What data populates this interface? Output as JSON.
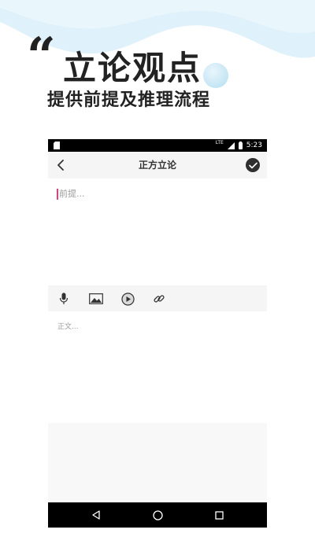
{
  "hero": {
    "quote_mark": "“",
    "title": "立论观点",
    "subtitle": "提供前提及推理流程"
  },
  "status_bar": {
    "network": "LTE",
    "time": "5:23"
  },
  "app_bar": {
    "title": "正方立论",
    "back_icon": "chevron-left-icon",
    "confirm_icon": "check-circle-icon"
  },
  "editor": {
    "premise_placeholder": "前提...",
    "body_placeholder": "正文..."
  },
  "toolbar": {
    "items": [
      {
        "icon": "microphone-icon"
      },
      {
        "icon": "image-icon"
      },
      {
        "icon": "play-circle-icon"
      },
      {
        "icon": "link-icon"
      }
    ]
  },
  "nav_bar": {
    "items": [
      {
        "icon": "back-triangle-icon"
      },
      {
        "icon": "home-circle-icon"
      },
      {
        "icon": "recents-square-icon"
      }
    ]
  },
  "colors": {
    "wave": "#dff1fa",
    "cursor": "#e0407a",
    "bar_background": "#f5f5f5",
    "text_dark": "#222222"
  }
}
